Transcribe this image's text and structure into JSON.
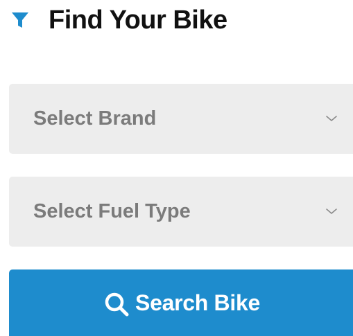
{
  "header": {
    "title": "Find Your Bike",
    "icon": "filter-icon"
  },
  "filters": {
    "brand": {
      "selected": "Select Brand",
      "icon": "chevron-down-icon"
    },
    "fuel_type": {
      "selected": "Select Fuel Type",
      "icon": "chevron-down-icon"
    }
  },
  "search_button": {
    "label": "Search Bike",
    "icon": "search-icon"
  },
  "colors": {
    "accent": "#1e8ccd",
    "select_background": "#ededed",
    "select_text": "#7b7b7b",
    "title_text": "#111111"
  }
}
